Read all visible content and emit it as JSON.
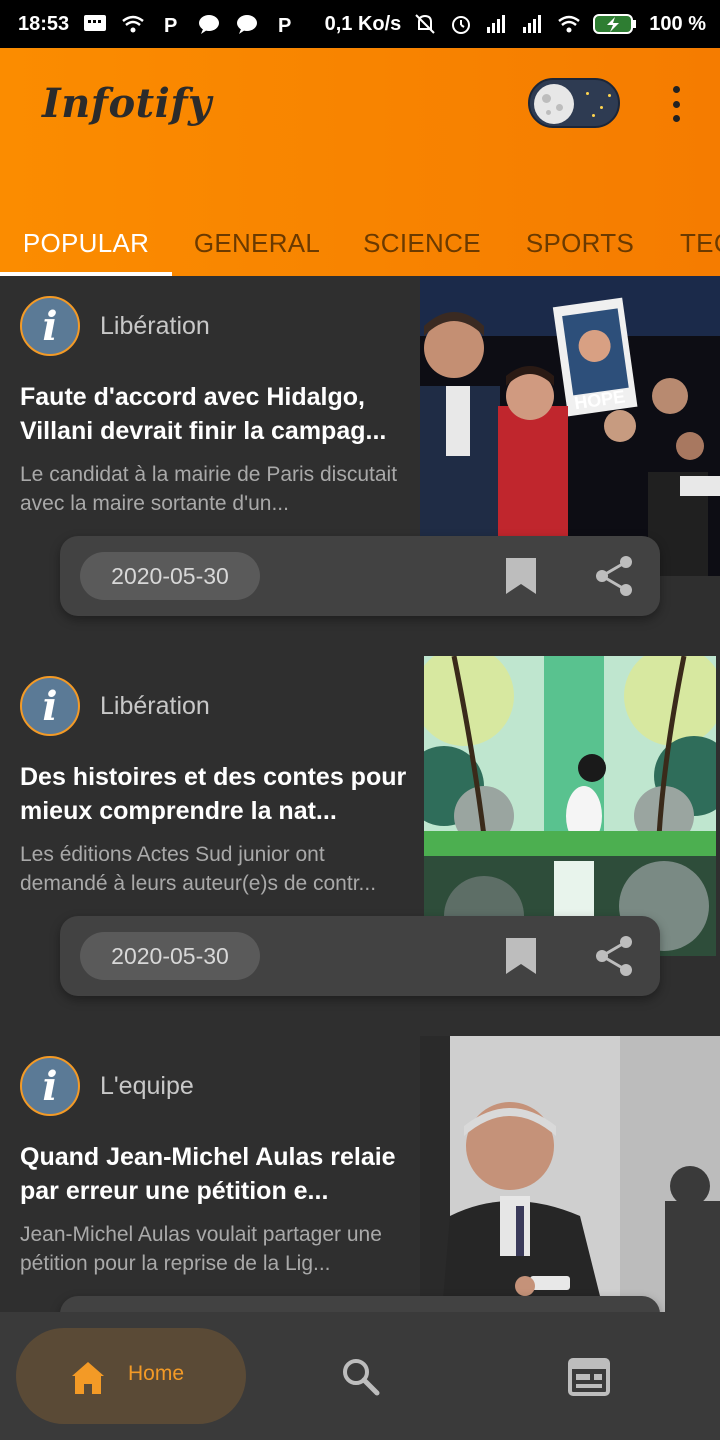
{
  "status_bar": {
    "time": "18:53",
    "network_speed": "0,1 Ko/s",
    "battery": "100 %",
    "icons": [
      "message-icon",
      "wifi-icon",
      "p-icon",
      "chat-icon",
      "chat-icon",
      "p-icon",
      "mute-icon",
      "alarm-icon",
      "signal-icon",
      "signal-icon",
      "wifi-icon",
      "battery-charging-icon"
    ]
  },
  "app_bar": {
    "brand": "Infotify",
    "theme_toggle": "night-mode-toggle",
    "menu_icon": "more-vert-icon"
  },
  "tabs": [
    {
      "label": "POPULAR",
      "active": true
    },
    {
      "label": "GENERAL",
      "active": false
    },
    {
      "label": "SCIENCE",
      "active": false
    },
    {
      "label": "SPORTS",
      "active": false
    },
    {
      "label": "TEC",
      "active": false
    }
  ],
  "articles": [
    {
      "source": "Libération",
      "title": "Faute d'accord avec Hidalgo, Villani devrait finir la campag...",
      "description": "Le candidat à la mairie de Paris discutait avec la maire sortante d'un...",
      "date": "2020-05-30",
      "image_text": "HOPE"
    },
    {
      "source": "Libération",
      "title": "Des histoires et des contes pour mieux comprendre la nat...",
      "description": "Les éditions Actes Sud junior ont demandé à leurs auteur(e)s de contr...",
      "date": "2020-05-30"
    },
    {
      "source": "L'equipe",
      "title": "Quand Jean-Michel Aulas relaie par erreur une pétition e...",
      "description": "Jean-Michel Aulas voulait partager une pétition pour la reprise de la Lig...",
      "date": ""
    }
  ],
  "bottom_nav": {
    "items": [
      {
        "label": "Home",
        "icon": "home-icon",
        "active": true
      },
      {
        "label": "",
        "icon": "search-icon",
        "active": false
      },
      {
        "label": "",
        "icon": "feed-icon",
        "active": false
      }
    ]
  },
  "colors": {
    "accent": "#f57c00",
    "tab_inactive": "#6b3a00",
    "background": "#2f2f2f",
    "card_action_bar": "#424242"
  }
}
